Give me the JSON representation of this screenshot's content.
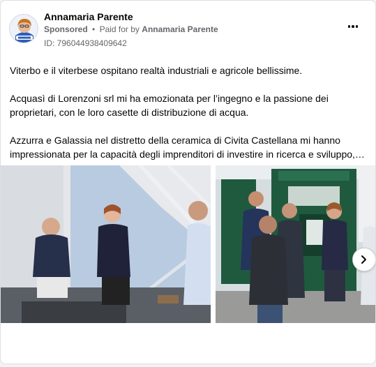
{
  "post": {
    "author": "Annamaria Parente",
    "sponsored_label": "Sponsored",
    "separator": "•",
    "paid_for_prefix": "Paid for by",
    "paid_for_by": "Annamaria Parente",
    "ad_id": "ID: 796044938409642",
    "paragraphs": [
      "Viterbo e il viterbese ospitano realtà industriali e agricole bellissime.",
      "Acquasì di Lorenzoni srl mi ha emozionata per l’ingegno e la passione dei proprietari, con le loro casette di distribuzione di acqua.",
      "Azzurra e Galassia nel distretto della ceramica di Civita Castellana mi hanno impressionata per la capacità degli imprenditori di investire in ricerca e sviluppo,…"
    ]
  },
  "icons": {
    "more": "more-horizontal-icon",
    "next": "chevron-right-icon"
  },
  "colors": {
    "text": "#050505",
    "secondary_text": "#65676b",
    "kiosk_green": "#1f5a3f"
  }
}
